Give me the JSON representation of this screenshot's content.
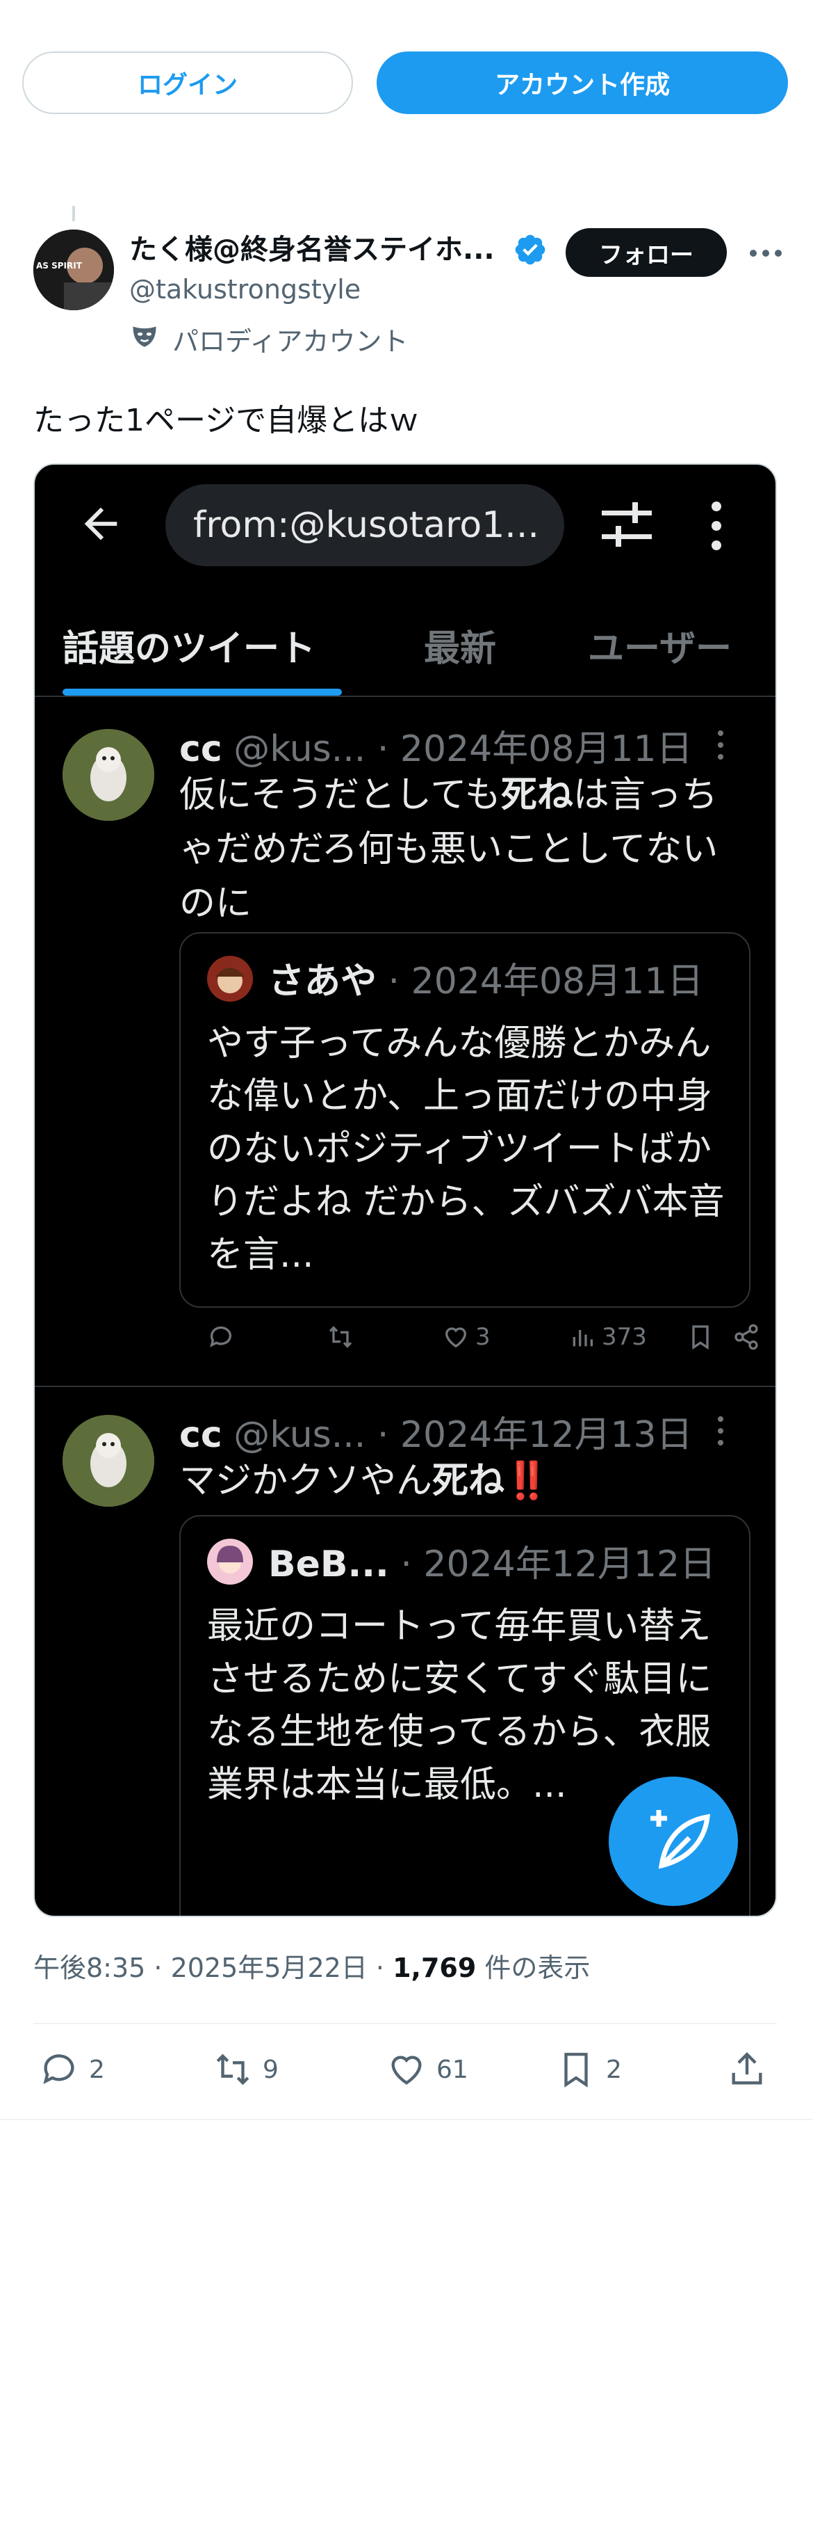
{
  "auth": {
    "login_label": "ログイン",
    "signup_label": "アカウント作成"
  },
  "author": {
    "name": "たく様@終身名誉ステイホ...",
    "handle": "@takustrongstyle",
    "follow_label": "フォロー",
    "badge": "パロディアカウント",
    "avatar_text": "AS SPIRIT"
  },
  "tweet": {
    "text": "たった1ページで自爆とはｗ"
  },
  "media": {
    "search_query": "from:@kusotaro1...",
    "tabs": [
      "話題のツイート",
      "最新",
      "ユーザー"
    ],
    "posts": [
      {
        "name": "cc",
        "handle": "@kus...",
        "date": "· 2024年08月11日",
        "body_pre": "仮にそうだとしても",
        "body_bold": "死ね",
        "body_post": "は言っちゃだめだろ何も悪いことしてないのに",
        "quote": {
          "name": "さあや",
          "date": "· 2024年08月11日",
          "text": "やす子ってみんな優勝とかみんな偉いとか、上っ面だけの中身のないポジティブツイートばかりだよね だから、ズバズバ本音を言..."
        },
        "actions": {
          "likes": "3",
          "views": "373"
        }
      },
      {
        "name": "cc",
        "handle": "@kus...",
        "date": "· 2024年12月13日",
        "body_pre": "マジかクソやん",
        "body_bold": "死ね",
        "body_post": "‼️",
        "quote": {
          "name": "BeB...",
          "date": "· 2024年12月12日",
          "text": "最近のコートって毎年買い替えさせるために安くてすぐ駄目になる生地を使ってるから、衣服業界は本当に最低。..."
        }
      }
    ]
  },
  "meta": {
    "time": "午後8:35",
    "dot": " · ",
    "date": "2025年5月22日",
    "views": "1,769",
    "views_label": " 件の表示"
  },
  "stats": {
    "replies": "2",
    "retweets": "9",
    "likes": "61",
    "bookmarks": "2"
  },
  "colors": {
    "accent": "#1d9bf0",
    "text": "#0f1419",
    "muted": "#536471",
    "dark_bg": "#000000"
  }
}
